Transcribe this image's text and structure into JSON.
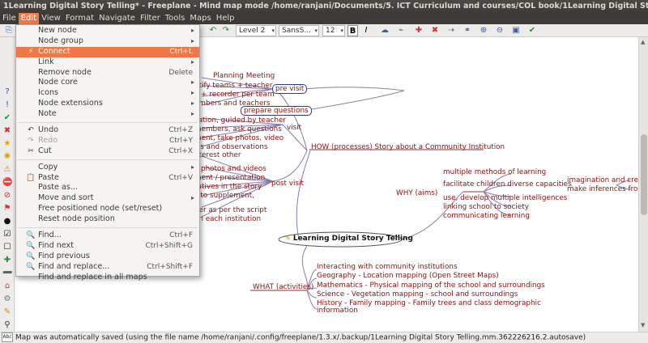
{
  "window": {
    "title": "1Learning Digital Story Telling* - Freeplane - Mind map mode /home/ranjani/Documents/5. ICT Curriculum and courses/COL book/1Learning Digital Story Telling.mm"
  },
  "menubar": [
    "File",
    "Edit",
    "View",
    "Format",
    "Navigate",
    "Filter",
    "Tools",
    "Maps",
    "Help"
  ],
  "menubar_active": "Edit",
  "toolbar": {
    "level": "Level 2",
    "font": "SansS...",
    "size": "12",
    "bold": "B",
    "italic": "I"
  },
  "edit_menu": [
    {
      "label": "New node",
      "shortcut": "",
      "submenu": true,
      "icon": "",
      "state": "normal"
    },
    {
      "label": "Node group",
      "shortcut": "",
      "submenu": true,
      "icon": "",
      "state": "normal"
    },
    {
      "label": "Connect",
      "shortcut": "Ctrl+L",
      "submenu": false,
      "icon": "connect-icon",
      "state": "highlighted"
    },
    {
      "label": "Link",
      "shortcut": "",
      "submenu": true,
      "icon": "",
      "state": "normal"
    },
    {
      "label": "Remove node",
      "shortcut": "Delete",
      "submenu": false,
      "icon": "",
      "state": "normal"
    },
    {
      "label": "Node core",
      "shortcut": "",
      "submenu": true,
      "icon": "",
      "state": "normal"
    },
    {
      "label": "Icons",
      "shortcut": "",
      "submenu": true,
      "icon": "",
      "state": "normal"
    },
    {
      "label": "Node extensions",
      "shortcut": "",
      "submenu": true,
      "icon": "",
      "state": "normal"
    },
    {
      "label": "Note",
      "shortcut": "",
      "submenu": true,
      "icon": "",
      "state": "normal"
    },
    {
      "label": "Undo",
      "shortcut": "Ctrl+Z",
      "submenu": false,
      "icon": "undo-icon",
      "state": "normal"
    },
    {
      "label": "Redo",
      "shortcut": "Ctrl+Y",
      "submenu": false,
      "icon": "redo-icon",
      "state": "disabled"
    },
    {
      "label": "Cut",
      "shortcut": "Ctrl+X",
      "submenu": false,
      "icon": "cut-icon",
      "state": "normal"
    },
    {
      "label": "Copy",
      "shortcut": "",
      "submenu": true,
      "icon": "",
      "state": "normal"
    },
    {
      "label": "Paste",
      "shortcut": "Ctrl+V",
      "submenu": false,
      "icon": "paste-icon",
      "state": "normal"
    },
    {
      "label": "Paste as...",
      "shortcut": "",
      "submenu": false,
      "icon": "",
      "state": "normal"
    },
    {
      "label": "Move and sort",
      "shortcut": "",
      "submenu": true,
      "icon": "",
      "state": "normal"
    },
    {
      "label": "Free positioned node (set/reset)",
      "shortcut": "",
      "submenu": false,
      "icon": "",
      "state": "normal"
    },
    {
      "label": "Reset node position",
      "shortcut": "",
      "submenu": false,
      "icon": "",
      "state": "normal"
    },
    {
      "label": "Find...",
      "shortcut": "Ctrl+F",
      "submenu": false,
      "icon": "find-icon",
      "state": "normal"
    },
    {
      "label": "Find next",
      "shortcut": "Ctrl+Shift+G",
      "submenu": false,
      "icon": "find-next-icon",
      "state": "normal"
    },
    {
      "label": "Find previous",
      "shortcut": "",
      "submenu": false,
      "icon": "find-previous-icon",
      "state": "normal"
    },
    {
      "label": "Find and replace...",
      "shortcut": "Ctrl+Shift+F",
      "submenu": false,
      "icon": "find-replace-icon",
      "state": "normal"
    },
    {
      "label": "Find and replace in all maps",
      "shortcut": "",
      "submenu": false,
      "icon": "",
      "state": "normal"
    }
  ],
  "mindmap": {
    "root": "Learning Digital Story Telling",
    "how_node": "HOW (processes) Story about a Community Institution",
    "pre_visit": "pre visit",
    "prepare_questions": "prepare questions",
    "visit": "visit",
    "post_visit": "post visit",
    "left_fragments": [
      "Planning Meeting",
      "ntify teams + teacher",
      "a + recorder per team",
      "embers and teachers",
      "cation, guided by teacher",
      "members, ask questions",
      "ment, take photos, video",
      "ws and observations",
      "nterest other",
      "y photos and videos",
      "ment / presentation",
      "ratives in the story",
      "s to supplement,",
      "her as per the script",
      "on each institution"
    ],
    "why_node": "WHY (aims)",
    "why_children": [
      "multiple methods of learning",
      "facilitate children diverse capacities",
      "use, develop multiple intelligences",
      "linking school to society",
      "communicating learning"
    ],
    "why_grandchildren": [
      "imagination and creat",
      "make inferences from"
    ],
    "what_node": "WHAT (activities)",
    "what_children": [
      "Interacting with community institutions",
      "Geography - Location mapping (Open Street Maps)",
      "Mathematics - Physical mapping of the school and surroundings",
      "Science - Vegetation mapping - school and surroundings",
      "History - Family mapping - Family trees and class demographic",
      "information"
    ]
  },
  "status": {
    "message": "Map was automatically saved (using the file name /home/ranjani/.config/freeplane/1.3.x/.backup/1Learning Digital Story Telling.mm.362226216.2.autosave)",
    "indicator": "Abc"
  },
  "colors": {
    "menu_highlight": "#f07746",
    "node_text": "#8a1212",
    "node_border": "#2b3d8f",
    "edge": "#8b7aa8"
  }
}
